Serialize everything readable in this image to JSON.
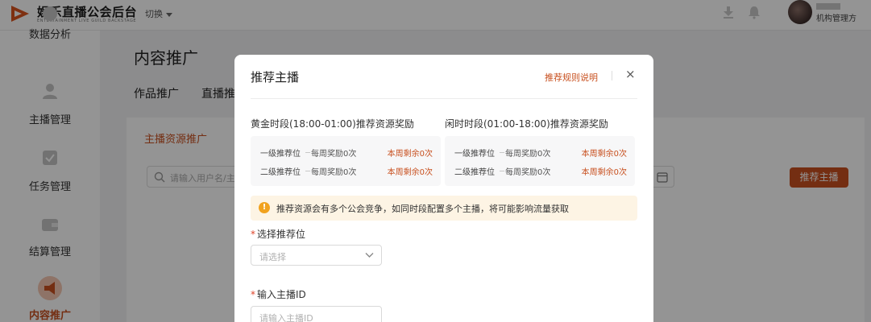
{
  "header": {
    "app_title": "娱乐直播公会后台",
    "app_subtitle": "ENTERTAINMENT LIVE GUILD BACKSTAGE",
    "switch_label": "切换",
    "user_role": "机构管理方"
  },
  "sidebar": {
    "items": [
      {
        "label": "数据分析",
        "icon": "chart-icon"
      },
      {
        "label": "主播管理",
        "icon": "user-icon"
      },
      {
        "label": "任务管理",
        "icon": "task-icon"
      },
      {
        "label": "结算管理",
        "icon": "wallet-icon"
      },
      {
        "label": "内容推广",
        "icon": "megaphone-icon",
        "active": true
      }
    ]
  },
  "main": {
    "title": "内容推广",
    "tabs": [
      "作品推广",
      "直播推"
    ],
    "subtab": "主播资源推广",
    "search_placeholder": "请输入用户名/主",
    "recommend_button": "推荐主播"
  },
  "modal": {
    "title": "推荐主播",
    "rule_link": "推荐规则说明",
    "close": "×",
    "sections": [
      {
        "title": "黄金时段(18:00-01:00)推荐资源奖励",
        "rows": [
          {
            "level": "一级推荐位",
            "reward": "每周奖励0次",
            "remaining": "本周剩余0次"
          },
          {
            "level": "二级推荐位",
            "reward": "每周奖励0次",
            "remaining": "本周剩余0次"
          }
        ]
      },
      {
        "title": "闲时时段(01:00-18:00)推荐资源奖励",
        "rows": [
          {
            "level": "一级推荐位",
            "reward": "每周奖励0次",
            "remaining": "本周剩余0次"
          },
          {
            "level": "二级推荐位",
            "reward": "每周奖励0次",
            "remaining": "本周剩余0次"
          }
        ]
      }
    ],
    "notice": "推荐资源会有多个公会竞争，如同时段配置多个主播，将可能影响流量获取",
    "notice_icon": "!",
    "slot_label": "选择推荐位",
    "slot_placeholder": "请选择",
    "anchor_label": "输入主播ID",
    "anchor_placeholder": "请输入主播ID",
    "required_mark": "*"
  },
  "colors": {
    "accent": "#c8501f",
    "warning": "#f1a21e",
    "notice_bg": "#fdf4e4"
  }
}
